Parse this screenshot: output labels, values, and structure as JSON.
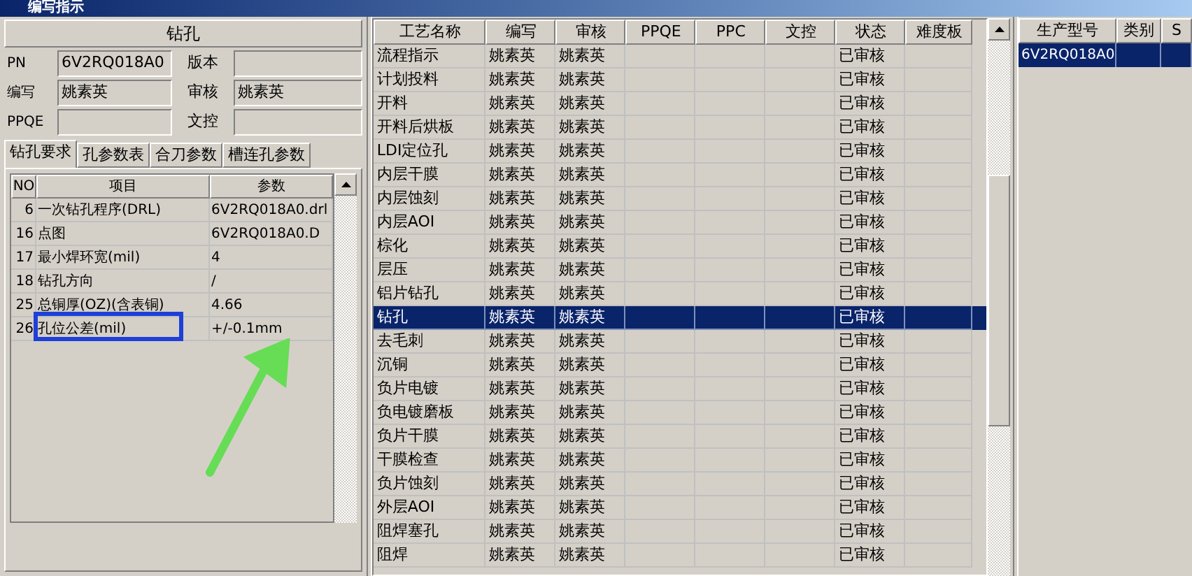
{
  "window": {
    "title": "编写指示"
  },
  "left_panel": {
    "heading": "钻孔",
    "fields": [
      {
        "label": "PN",
        "value": "6V2RQ018A0"
      },
      {
        "label": "版本"
      },
      {
        "label": "编写",
        "value": "姚素英"
      },
      {
        "label": "审核",
        "value": "姚素英"
      },
      {
        "label": "PPQE"
      },
      {
        "label": "文控"
      }
    ],
    "tabs": [
      {
        "label": "钻孔要求",
        "selected": true
      },
      {
        "label": "孔参数表",
        "selected": false
      },
      {
        "label": "合刀参数",
        "selected": false
      },
      {
        "label": "槽连孔参数",
        "selected": false
      }
    ],
    "grid": {
      "columns": [
        "NO",
        "项目",
        "参数"
      ],
      "rows": [
        [
          "6",
          "一次钻孔程序(DRL)",
          "6V2RQ018A0.drl"
        ],
        [
          "16",
          "点图",
          "6V2RQ018A0.D"
        ],
        [
          "17",
          "最小焊环宽(mil)",
          "4"
        ],
        [
          "18",
          "钻孔方向",
          "/"
        ],
        [
          "25",
          "总铜厚(OZ)(含表铜)",
          "4.66"
        ],
        [
          "26",
          "孔位公差(mil)",
          "+/-0.1mm"
        ]
      ]
    }
  },
  "process_table": {
    "columns": [
      "工艺名称",
      "编写",
      "审核",
      "PPQE",
      "PPC",
      "文控",
      "状态",
      "难度板"
    ],
    "rows": [
      {
        "cells": [
          "流程指示",
          "姚素英",
          "姚素英",
          "",
          "",
          "",
          "已审核",
          ""
        ],
        "selected": false
      },
      {
        "cells": [
          "计划投料",
          "姚素英",
          "姚素英",
          "",
          "",
          "",
          "已审核",
          ""
        ],
        "selected": false
      },
      {
        "cells": [
          "开料",
          "姚素英",
          "姚素英",
          "",
          "",
          "",
          "已审核",
          ""
        ],
        "selected": false
      },
      {
        "cells": [
          "开料后烘板",
          "姚素英",
          "姚素英",
          "",
          "",
          "",
          "已审核",
          ""
        ],
        "selected": false
      },
      {
        "cells": [
          "LDI定位孔",
          "姚素英",
          "姚素英",
          "",
          "",
          "",
          "已审核",
          ""
        ],
        "selected": false
      },
      {
        "cells": [
          "内层干膜",
          "姚素英",
          "姚素英",
          "",
          "",
          "",
          "已审核",
          ""
        ],
        "selected": false
      },
      {
        "cells": [
          "内层蚀刻",
          "姚素英",
          "姚素英",
          "",
          "",
          "",
          "已审核",
          ""
        ],
        "selected": false
      },
      {
        "cells": [
          "内层AOI",
          "姚素英",
          "姚素英",
          "",
          "",
          "",
          "已审核",
          ""
        ],
        "selected": false
      },
      {
        "cells": [
          "棕化",
          "姚素英",
          "姚素英",
          "",
          "",
          "",
          "已审核",
          ""
        ],
        "selected": false
      },
      {
        "cells": [
          "层压",
          "姚素英",
          "姚素英",
          "",
          "",
          "",
          "已审核",
          ""
        ],
        "selected": false
      },
      {
        "cells": [
          "铝片钻孔",
          "姚素英",
          "姚素英",
          "",
          "",
          "",
          "已审核",
          ""
        ],
        "selected": false
      },
      {
        "cells": [
          "钻孔",
          "姚素英",
          "姚素英",
          "",
          "",
          "",
          "已审核",
          ""
        ],
        "selected": true
      },
      {
        "cells": [
          "去毛刺",
          "姚素英",
          "姚素英",
          "",
          "",
          "",
          "已审核",
          ""
        ],
        "selected": false
      },
      {
        "cells": [
          "沉铜",
          "姚素英",
          "姚素英",
          "",
          "",
          "",
          "已审核",
          ""
        ],
        "selected": false
      },
      {
        "cells": [
          "负片电镀",
          "姚素英",
          "姚素英",
          "",
          "",
          "",
          "已审核",
          ""
        ],
        "selected": false
      },
      {
        "cells": [
          "负电镀磨板",
          "姚素英",
          "姚素英",
          "",
          "",
          "",
          "已审核",
          ""
        ],
        "selected": false
      },
      {
        "cells": [
          "负片干膜",
          "姚素英",
          "姚素英",
          "",
          "",
          "",
          "已审核",
          ""
        ],
        "selected": false
      },
      {
        "cells": [
          "干膜检查",
          "姚素英",
          "姚素英",
          "",
          "",
          "",
          "已审核",
          ""
        ],
        "selected": false
      },
      {
        "cells": [
          "负片蚀刻",
          "姚素英",
          "姚素英",
          "",
          "",
          "",
          "已审核",
          ""
        ],
        "selected": false
      },
      {
        "cells": [
          "外层AOI",
          "姚素英",
          "姚素英",
          "",
          "",
          "",
          "已审核",
          ""
        ],
        "selected": false
      },
      {
        "cells": [
          "阻焊塞孔",
          "姚素英",
          "姚素英",
          "",
          "",
          "",
          "已审核",
          ""
        ],
        "selected": false
      },
      {
        "cells": [
          "阻焊",
          "姚素英",
          "姚素英",
          "",
          "",
          "",
          "已审核",
          ""
        ],
        "selected": false
      }
    ]
  },
  "model_table": {
    "columns": [
      "生产型号",
      "类别",
      "S"
    ],
    "rows": [
      {
        "cells": [
          "6V2RQ018A0",
          "",
          ""
        ],
        "selected": true
      }
    ]
  }
}
